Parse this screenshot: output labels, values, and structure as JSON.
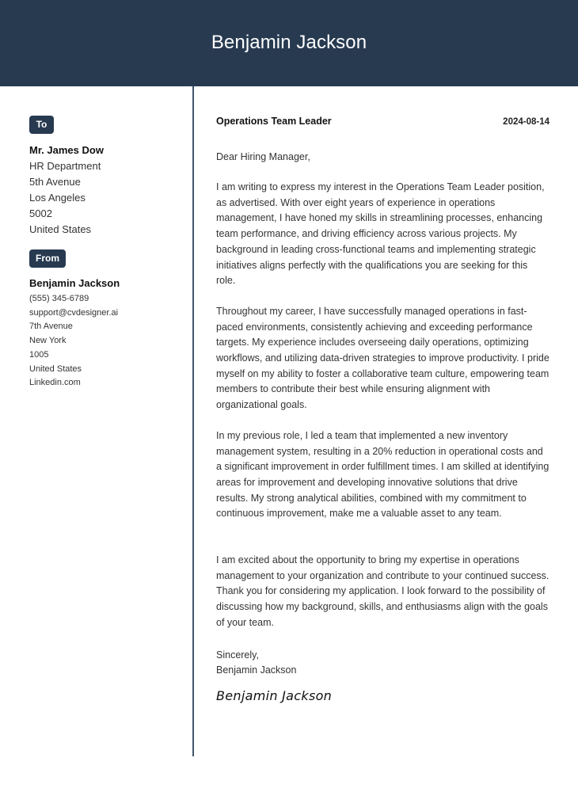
{
  "header": {
    "name": "Benjamin Jackson",
    "background_color": "#273a50"
  },
  "recipient": {
    "badge_label": "To",
    "name": "Mr. James Dow",
    "lines": [
      "HR Department",
      "5th Avenue",
      "Los Angeles",
      "5002",
      "United States"
    ]
  },
  "sender": {
    "badge_label": "From",
    "name": "Benjamin Jackson",
    "lines": [
      "(555) 345-6789",
      "support@cvdesigner.ai",
      "7th Avenue",
      "New York",
      "1005",
      "United States",
      "Linkedin.com"
    ]
  },
  "letter": {
    "job_title": "Operations Team Leader",
    "date": "2024-08-14",
    "salutation": "Dear Hiring Manager,",
    "paragraphs": [
      "I am writing to express my interest in the Operations Team Leader position, as advertised. With over eight years of experience in operations management, I have honed my skills in streamlining processes, enhancing team performance, and driving efficiency across various projects. My background in leading cross-functional teams and implementing strategic initiatives aligns perfectly with the qualifications you are seeking for this role.",
      "Throughout my career, I have successfully managed operations in fast-paced environments, consistently achieving and exceeding performance targets. My experience includes overseeing daily operations, optimizing workflows, and utilizing data-driven strategies to improve productivity. I pride myself on my ability to foster a collaborative team culture, empowering team members to contribute their best while ensuring alignment with organizational goals.",
      "In my previous role, I led a team that implemented a new inventory management system, resulting in a 20% reduction in operational costs and a significant improvement in order fulfillment times. I am skilled at identifying areas for improvement and developing innovative solutions that drive results. My strong analytical abilities, combined with my commitment to continuous improvement, make me a valuable asset to any team.",
      "I am excited about the opportunity to bring my expertise in operations management to your organization and contribute to your continued success. Thank you for considering my application. I look forward to the possibility of discussing how my background, skills, and enthusiasms align with the goals of your team."
    ],
    "closing": "Sincerely,",
    "closing_name": "Benjamin Jackson",
    "signature": "Benjamin Jackson"
  }
}
